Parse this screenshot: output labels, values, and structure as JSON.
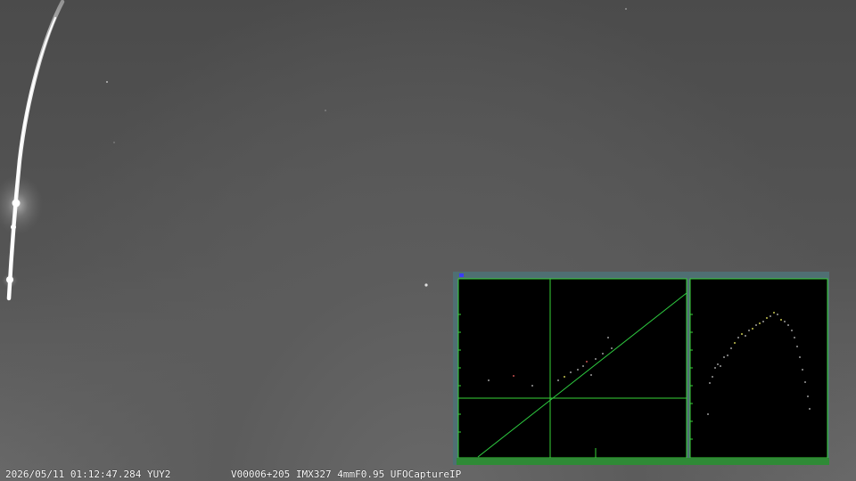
{
  "overlay": {
    "datetime_format": "2026/05/11 01:12:47.284 YUY2",
    "camera_info": "V00006+205 IMX327 4mmF0.95 UFOCaptureIP"
  },
  "analysis": {
    "frame_color": "#38d438",
    "background_color": "#000000",
    "panel_color": "#4f6f73",
    "trajectory_color": "#2ecc40",
    "point_colors": [
      "#c8c8c8",
      "#ffff66",
      "#ff6666"
    ]
  },
  "scene": {
    "meteor_color": "#ffffff",
    "sky_color": "#4f4f4f"
  }
}
